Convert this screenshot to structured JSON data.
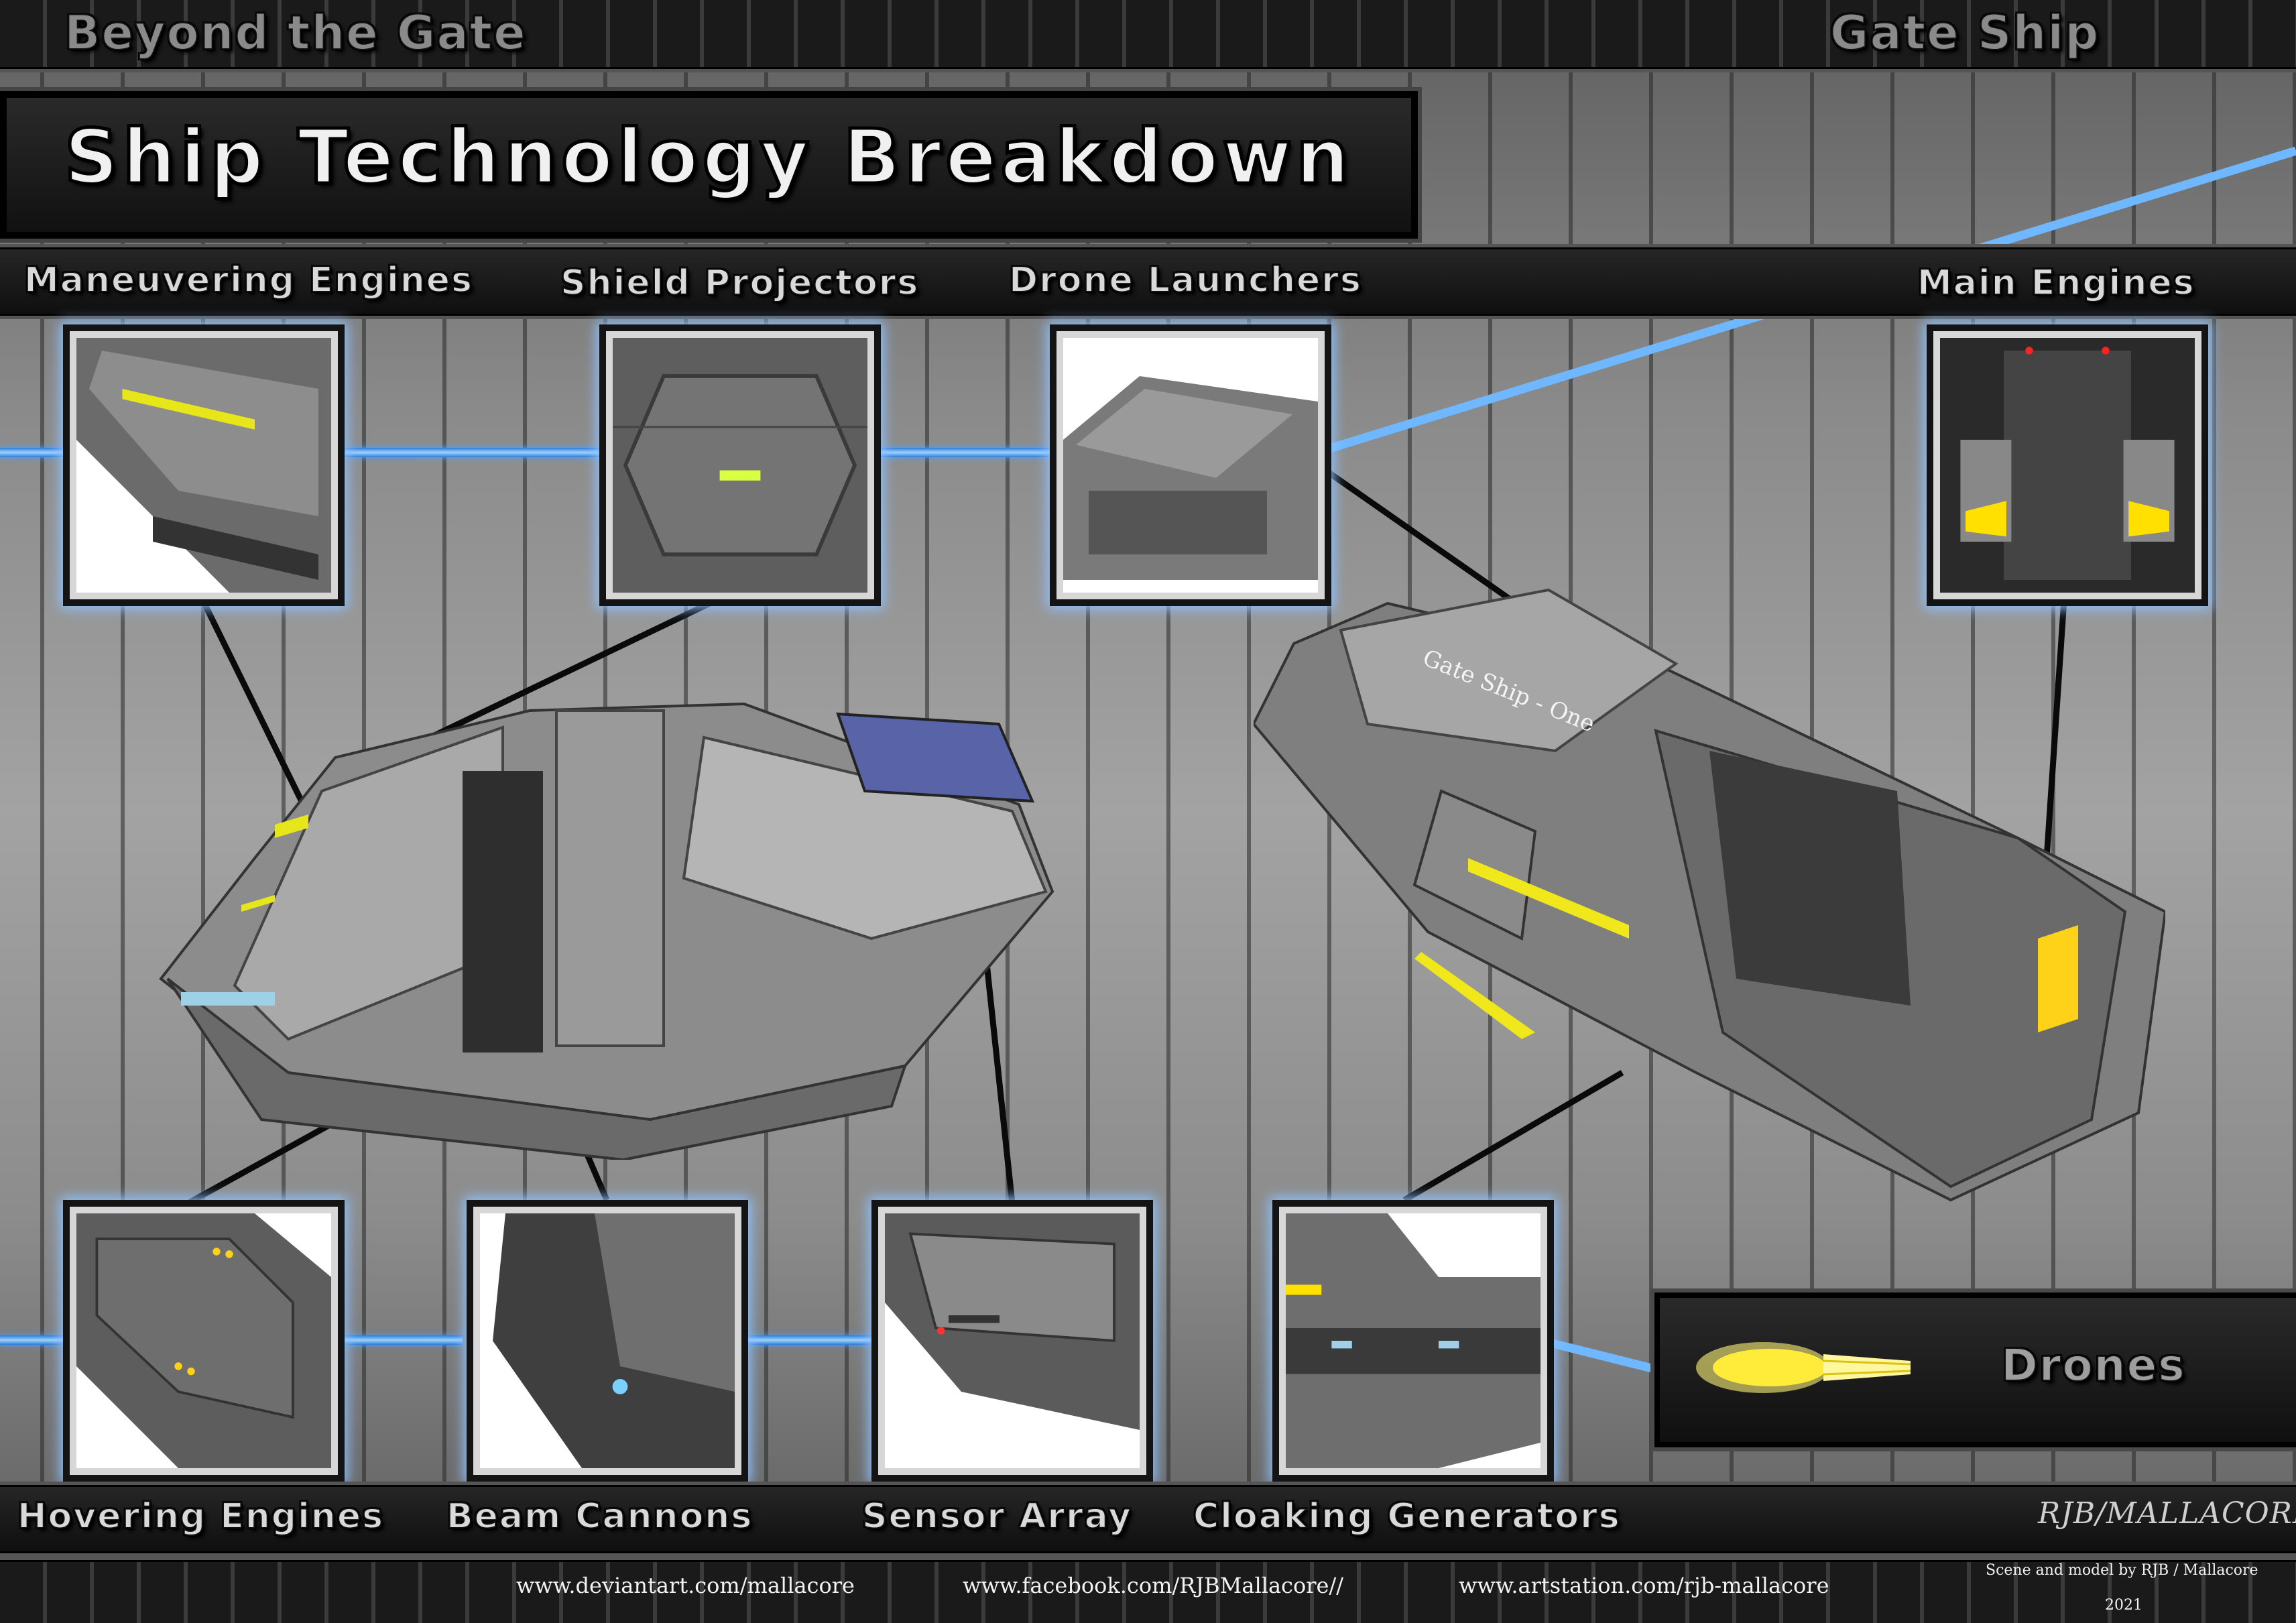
{
  "header": {
    "series_title": "Beyond the Gate",
    "ship_name": "Gate Ship",
    "main_title": "Ship Technology Breakdown"
  },
  "top_labels": {
    "maneuvering": "Maneuvering Engines",
    "shield": "Shield Projectors",
    "drone": "Drone Launchers",
    "main_engines": "Main Engines"
  },
  "bottom_labels": {
    "hovering": "Hovering Engines",
    "beam": "Beam Cannons",
    "sensor": "Sensor Array",
    "cloaking": "Cloaking Generators"
  },
  "drones_panel": {
    "label": "Drones"
  },
  "ship_hull_text": "Gate Ship - One",
  "footer": {
    "signature": "RJB/MALLACORE",
    "links": [
      "www.deviantart.com/mallacore",
      "www.facebook.com/RJBMallacore//",
      "www.artstation.com/rjb-mallacore"
    ],
    "credit": "Scene and model by RJB / Mallacore",
    "year": "2021"
  },
  "colors": {
    "accent_blue": "#5aaeff",
    "glow_yellow": "#ffee33",
    "panel_dark": "#1a1a1a"
  }
}
